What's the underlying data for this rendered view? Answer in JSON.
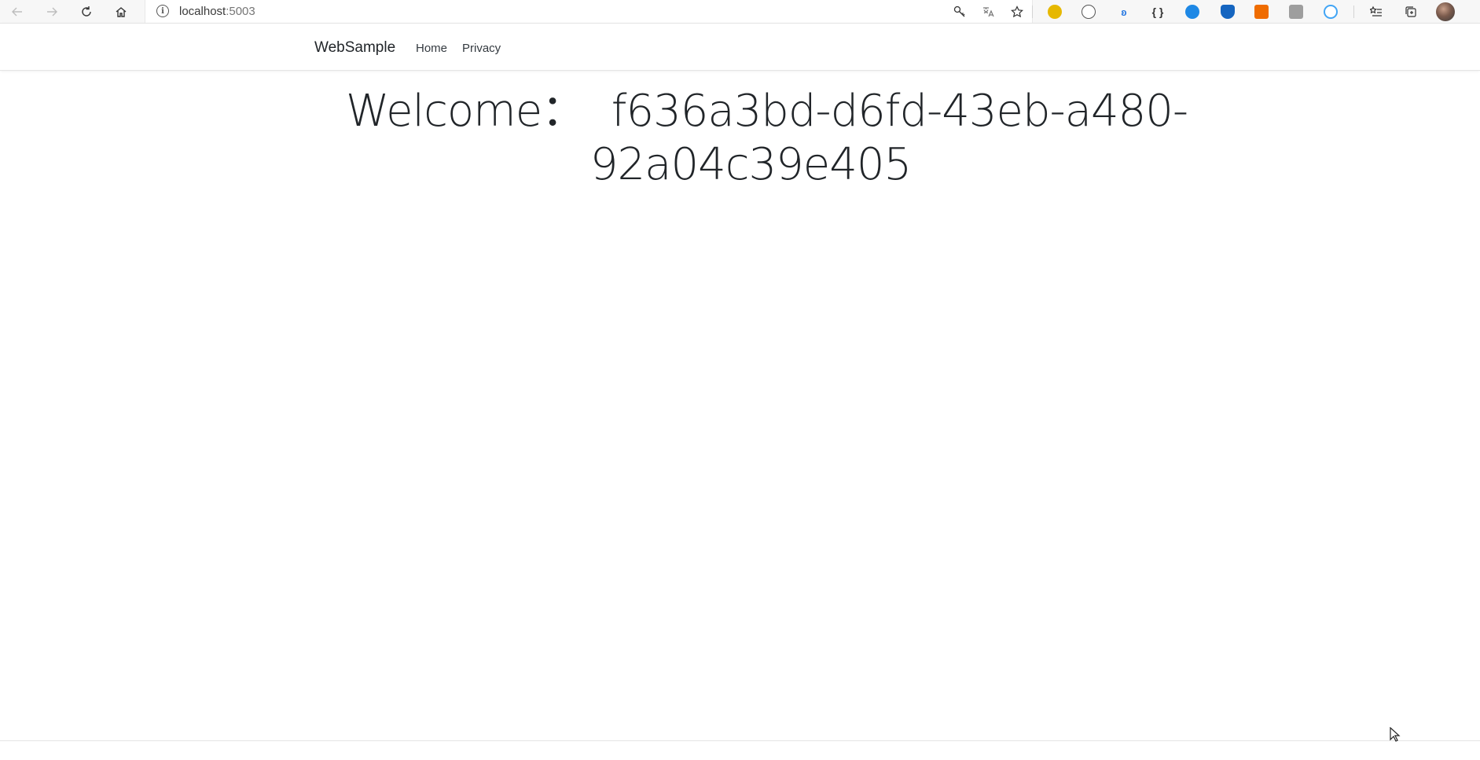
{
  "browser": {
    "address": {
      "host": "localhost",
      "port": ":5003"
    },
    "icons": {
      "back": "arrow-left-icon",
      "forward": "arrow-right-icon",
      "reload": "reload-icon",
      "home": "home-icon",
      "info": "info-icon",
      "key": "key-icon",
      "translate": "translate-icon",
      "favorite": "star-icon",
      "favorites": "favorites-list-icon",
      "collections": "collections-icon",
      "profile": "avatar"
    }
  },
  "navbar": {
    "brand": "WebSample",
    "links": [
      "Home",
      "Privacy"
    ]
  },
  "main": {
    "welcome_line1": "Welcome：  f636a3bd-d6fd-43eb-a480-",
    "welcome_line2": "92a04c39e405"
  }
}
